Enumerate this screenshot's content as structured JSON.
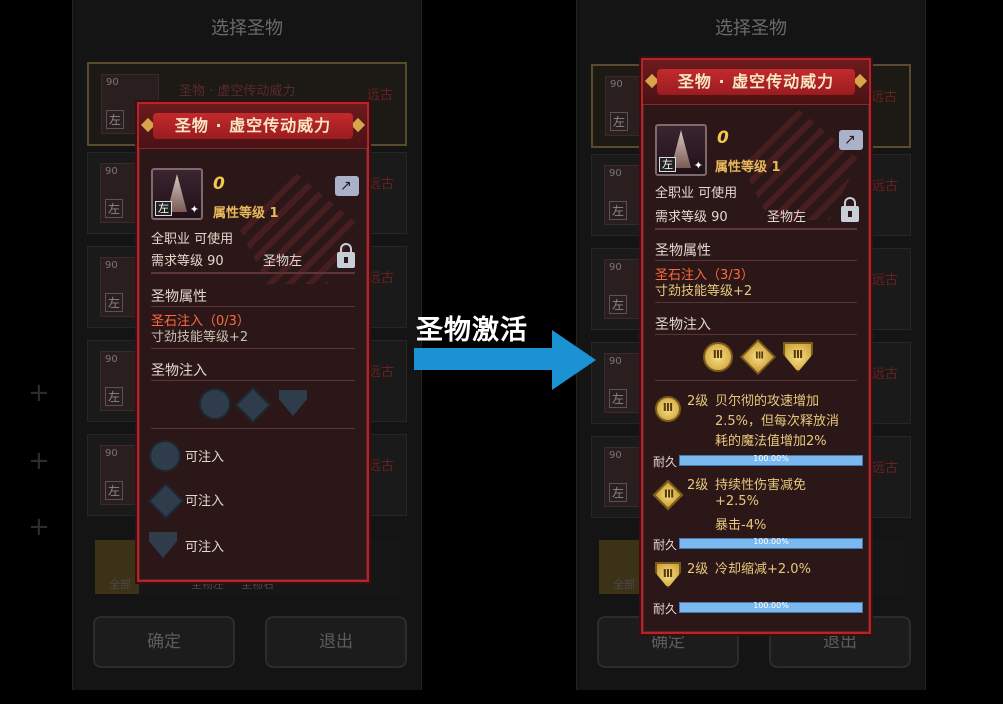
{
  "background_screen": {
    "title": "选择圣物",
    "item_level": "90",
    "item_side": "左",
    "item_name": "圣物 · 虚空传动威力",
    "item_tag": "远古",
    "filter_tabs": [
      "全部",
      "圣物左",
      "圣物右"
    ],
    "confirm_label": "确定",
    "exit_label": "退出"
  },
  "arrow_label": "圣物激活",
  "panel_before": {
    "title": "圣物 · 虚空传动威力",
    "icon_side": "左",
    "level_value": "0",
    "attr_level": "属性等级 1",
    "job": "全职业 可使用",
    "req_level": "需求等级 90",
    "slot": "圣物左",
    "attr_section": "圣物属性",
    "stone_inject": "圣石注入（0/3）",
    "skill_level": "寸劲技能等级+2",
    "inject_section": "圣物注入",
    "slots": [
      {
        "label": "可注入"
      },
      {
        "label": "可注入"
      },
      {
        "label": "可注入"
      }
    ]
  },
  "panel_after": {
    "title": "圣物 · 虚空传动威力",
    "icon_side": "左",
    "level_value": "0",
    "attr_level": "属性等级 1",
    "job": "全职业 可使用",
    "req_level": "需求等级 90",
    "slot": "圣物左",
    "attr_section": "圣物属性",
    "stone_inject": "圣石注入（3/3）",
    "skill_level": "寸劲技能等级+2",
    "inject_section": "圣物注入",
    "gem_glyph": "Ⅲ",
    "effects": [
      {
        "level": "2级",
        "lines": [
          "贝尔彻的攻速增加",
          "2.5%，但每次释放消",
          "耗的魔法值增加2%"
        ],
        "durability_label": "耐久",
        "durability_text": "100.00%",
        "durability_pct": 100
      },
      {
        "level": "2级",
        "lines": [
          "持续性伤害减免",
          "+2.5%",
          "暴击-4%"
        ],
        "durability_label": "耐久",
        "durability_text": "100.00%",
        "durability_pct": 100
      },
      {
        "level": "2级",
        "lines": [
          "冷却缩减+2.0%"
        ],
        "durability_label": "耐久",
        "durability_text": "100.00%",
        "durability_pct": 100
      }
    ]
  }
}
